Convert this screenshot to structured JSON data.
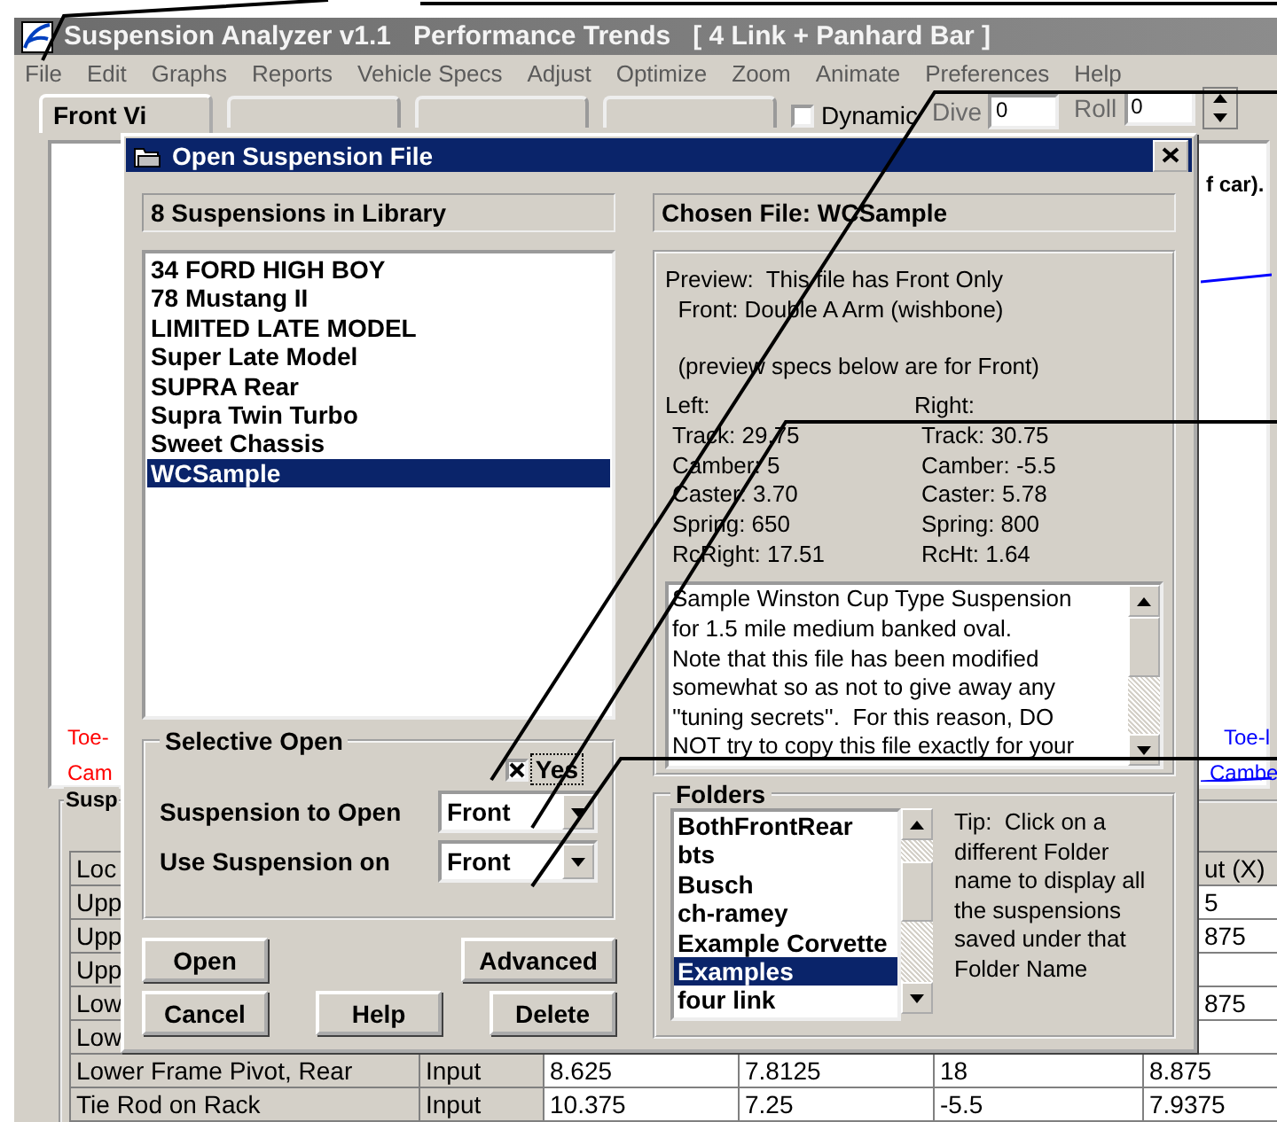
{
  "window": {
    "title": "Suspension Analyzer v1.1   Performance Trends   [ 4 Link + Panhard Bar ]"
  },
  "menu": [
    {
      "label": "File"
    },
    {
      "label": "Edit"
    },
    {
      "label": "Graphs"
    },
    {
      "label": "Reports"
    },
    {
      "label": "Vehicle Specs"
    },
    {
      "label": "Adjust"
    },
    {
      "label": "Optimize"
    },
    {
      "label": "Zoom"
    },
    {
      "label": "Animate"
    },
    {
      "label": "Preferences"
    },
    {
      "label": "Help"
    }
  ],
  "tabs": [
    {
      "label": "Front Vi",
      "selected": true
    },
    {
      "selected": false
    },
    {
      "selected": false
    },
    {
      "selected": false
    }
  ],
  "dynamic": {
    "label": "Dynamic",
    "checked": false
  },
  "dive": {
    "label": "Dive",
    "value": "0"
  },
  "roll": {
    "label": "Roll",
    "value": "0"
  },
  "graph": {
    "caption": "f car).",
    "left_labels": [
      {
        "text": "Toe-",
        "color": "#ff0000"
      },
      {
        "text": "Cam",
        "color": "#ff0000"
      }
    ],
    "right_labels": [
      {
        "text": "Toe-l",
        "color": "#0000ff"
      },
      {
        "text": "Cambe",
        "color": "#0000ff"
      }
    ]
  },
  "table": {
    "title": "Susp",
    "rows": [
      {
        "cells": [
          "Loc",
          null,
          null,
          null,
          null,
          "ut (X)"
        ]
      },
      {
        "cells": [
          "Upp",
          null,
          null,
          null,
          null,
          "5"
        ]
      },
      {
        "cells": [
          "Upp",
          null,
          null,
          null,
          null,
          "875"
        ]
      },
      {
        "cells": [
          "Upp",
          null,
          null,
          null,
          null,
          null
        ]
      },
      {
        "cells": [
          "Low",
          null,
          null,
          null,
          null,
          "875"
        ]
      },
      {
        "cells": [
          "Low",
          null,
          null,
          null,
          null,
          null
        ]
      },
      {
        "cells": [
          "Lower Frame Pivot, Rear",
          "Input",
          "8.625",
          "7.8125",
          "18",
          "8.875"
        ]
      },
      {
        "cells": [
          "Tie Rod on Rack",
          "Input",
          "10.375",
          "7.25",
          "-5.5",
          "7.9375"
        ]
      }
    ]
  },
  "dialog": {
    "title": "Open Suspension File",
    "library_header": "8 Suspensions in Library",
    "suspensions": [
      {
        "label": "34 FORD HIGH BOY",
        "selected": false
      },
      {
        "label": "78 Mustang II",
        "selected": false
      },
      {
        "label": "LIMITED LATE MODEL",
        "selected": false
      },
      {
        "label": "Super Late Model",
        "selected": false
      },
      {
        "label": "SUPRA Rear",
        "selected": false
      },
      {
        "label": "Supra Twin Turbo",
        "selected": false
      },
      {
        "label": "Sweet Chassis",
        "selected": false
      },
      {
        "label": "WCSample",
        "selected": true
      }
    ],
    "selective_open": {
      "title": "Selective Open",
      "yes": {
        "label": "Yes",
        "checked": true
      },
      "fields": [
        {
          "label": "Suspension to Open",
          "value": "Front"
        },
        {
          "label": "Use Suspension on",
          "value": "Front"
        }
      ]
    },
    "buttons": [
      [
        "Open",
        "Advanced"
      ],
      [
        "Cancel",
        "Help",
        "Delete"
      ]
    ],
    "chosen_header": "Chosen File: WCSample",
    "preview": {
      "lines": [
        "Preview:  This file has Front Only",
        "  Front: Double A Arm (wishbone)"
      ],
      "note": "  (preview specs below are for Front)",
      "columns": [
        {
          "heading": "Left:",
          "specs": [
            "Track: 29.75",
            "Camber: 5",
            "Caster: 3.70",
            "Spring: 650",
            "RcRight: 17.51"
          ]
        },
        {
          "heading": "Right:",
          "specs": [
            "Track: 30.75",
            "Camber: -5.5",
            "Caster: 5.78",
            "Spring: 800",
            "RcHt: 1.64"
          ]
        }
      ]
    },
    "notes": "Sample Winston Cup Type Suspension\nfor 1.5 mile medium banked oval.\nNote that this file has been modified\nsomewhat so as not to give away any\n''tuning secrets''.  For this reason, DO\nNOT try to copy this file exactly for your",
    "folders": {
      "title": "Folders",
      "items": [
        {
          "label": "BothFrontRear",
          "selected": false
        },
        {
          "label": "bts",
          "selected": false
        },
        {
          "label": "Busch",
          "selected": false
        },
        {
          "label": "ch-ramey",
          "selected": false
        },
        {
          "label": "Example Corvette",
          "selected": false
        },
        {
          "label": "Examples",
          "selected": true
        },
        {
          "label": "four link",
          "selected": false
        }
      ],
      "tip": "Tip:  Click on a\ndifferent Folder\nname to display all\nthe suspensions\nsaved under that\nFolder Name"
    }
  }
}
